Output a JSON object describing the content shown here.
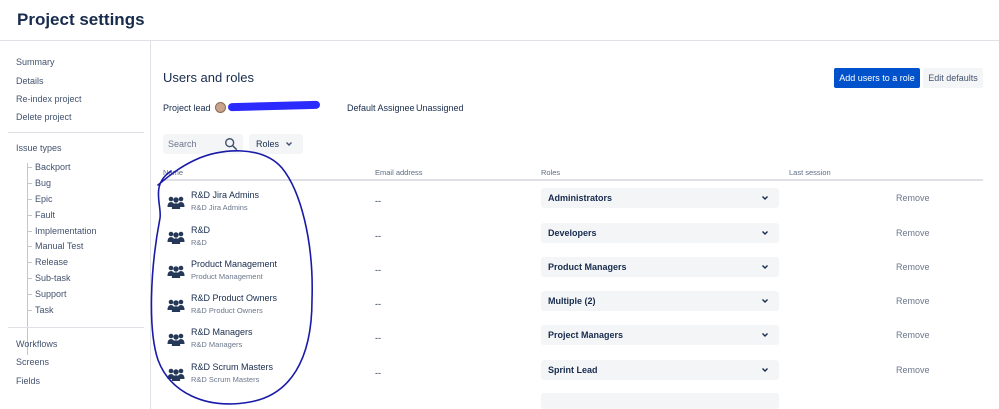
{
  "page": {
    "title": "Project settings"
  },
  "sidebar": {
    "items": [
      {
        "label": "Summary"
      },
      {
        "label": "Details"
      },
      {
        "label": "Re-index project"
      },
      {
        "label": "Delete project"
      }
    ],
    "issue_types": {
      "label": "Issue types",
      "items": [
        "Backport",
        "Bug",
        "Epic",
        "Fault",
        "Implementation",
        "Manual Test",
        "Release",
        "Sub-task",
        "Support",
        "Task"
      ]
    },
    "bottom_items": [
      {
        "label": "Workflows"
      },
      {
        "label": "Screens"
      },
      {
        "label": "Fields"
      }
    ]
  },
  "main": {
    "title": "Users and roles",
    "add_users_button": "Add users to a role",
    "edit_defaults_button": "Edit defaults",
    "project_lead_label": "Project lead",
    "default_assignee_label": "Default Assignee",
    "default_assignee_value": "Unassigned",
    "search": {
      "placeholder": "Search"
    },
    "roles_filter": {
      "label": "Roles"
    },
    "columns": {
      "name": "Name",
      "email": "Email address",
      "roles": "Roles",
      "last_session": "Last session"
    },
    "rows": [
      {
        "name": "R&D Jira Admins",
        "sub": "R&D Jira Admins",
        "email": "--",
        "role": "Administrators",
        "remove": "Remove"
      },
      {
        "name": "R&D",
        "sub": "R&D",
        "email": "--",
        "role": "Developers",
        "remove": "Remove"
      },
      {
        "name": "Product Management",
        "sub": "Product Management",
        "email": "--",
        "role": "Product Managers",
        "remove": "Remove"
      },
      {
        "name": "R&D Product Owners",
        "sub": "R&D Product Owners",
        "email": "--",
        "role": "Multiple (2)",
        "remove": "Remove"
      },
      {
        "name": "R&D Managers",
        "sub": "R&D Managers",
        "email": "--",
        "role": "Project Managers",
        "remove": "Remove"
      },
      {
        "name": "R&D Scrum Masters",
        "sub": "R&D Scrum Masters",
        "email": "--",
        "role": "Sprint Lead",
        "remove": "Remove"
      }
    ]
  },
  "colors": {
    "primary": "#0052cc",
    "annotation_ink": "#1a1aa8",
    "redaction": "#2b2bff"
  },
  "icons": [
    "search-icon",
    "chevron-down-icon",
    "group-icon"
  ]
}
